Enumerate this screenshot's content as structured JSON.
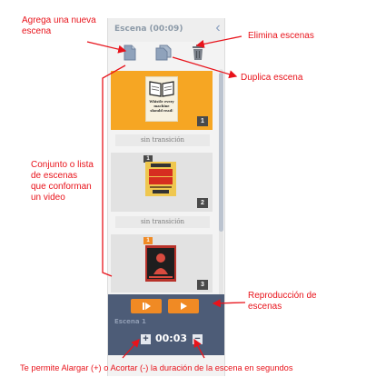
{
  "panel": {
    "title": "Escena  (00:09)",
    "toolbar": {
      "add_icon": "document-icon",
      "duplicate_icon": "copy-icon",
      "delete_icon": "trash-icon"
    },
    "scenes": [
      {
        "number": "1",
        "selected": true,
        "thumb_text": [
          "Whistle every",
          "machine",
          "should read!"
        ]
      },
      {
        "number": "2",
        "selected": false
      },
      {
        "number": "3",
        "selected": false
      }
    ],
    "transitions": [
      "sin transición",
      "sin transición"
    ],
    "playback": {
      "scene_label": "Escena 1",
      "duration": "00:03",
      "plus": "+",
      "minus": "−"
    }
  },
  "annotations": {
    "add_scene": [
      "Agrega una nueva",
      "escena"
    ],
    "delete_scenes": "Elimina escenas",
    "duplicate_scene": "Duplica escena",
    "scene_list": [
      "Conjunto o lista",
      "de escenas",
      "que conforman",
      "un video"
    ],
    "playback": [
      "Reproducción de",
      "escenas"
    ],
    "duration_note": "Te permite Alargar (+) o Acortar (-) la duración de la escena en segundos"
  },
  "colors": {
    "accent_orange": "#f6a623",
    "play_orange": "#f08a24",
    "playbar_bg": "#4d5c77",
    "annotation_red": "#e8131b"
  }
}
